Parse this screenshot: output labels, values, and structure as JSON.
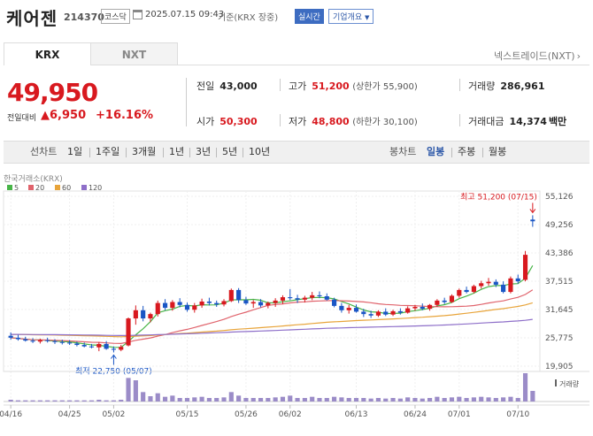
{
  "header": {
    "stock_name": "케어젠",
    "stock_code": "214370",
    "market_badge": "코스닥",
    "datetime": "2025.07.15 09:43",
    "basis": "기준(KRX 장중)",
    "realtime_badge": "실시간",
    "company_info_button": "기업개요"
  },
  "tabs": [
    {
      "label": "KRX"
    },
    {
      "label": "NXT"
    }
  ],
  "nxt_link": "넥스트레이드(NXT)",
  "quote": {
    "price": "49,950",
    "change_label": "전일대비",
    "change_value": "6,950",
    "change_pct": "+16.16%",
    "prev_close_label": "전일",
    "prev_close": "43,000",
    "high_label": "고가",
    "high": "51,200",
    "upper_limit": "(상한가 55,900)",
    "volume_label": "거래량",
    "volume": "286,961",
    "open_label": "시가",
    "open": "50,300",
    "low_label": "저가",
    "low": "48,800",
    "lower_limit": "(하한가 30,100)",
    "trade_value_label": "거래대금",
    "trade_value": "14,374",
    "trade_value_unit": "백만"
  },
  "period_bar": {
    "line_chart_label": "선차트",
    "periods": [
      "1일",
      "1주일",
      "3개월",
      "1년",
      "3년",
      "5년",
      "10년"
    ],
    "candle_label": "봉차트",
    "candle_periods": [
      "일봉",
      "주봉",
      "월봉"
    ],
    "selected_candle": "일봉"
  },
  "colors": {
    "up": "#d8191f",
    "down": "#1a56c5",
    "accent": "#2d58a8"
  },
  "chart_data": {
    "type": "candlestick",
    "title": "한국거래소(KRX)",
    "legend": [
      {
        "name": "5",
        "color": "#48b548"
      },
      {
        "name": "20",
        "color": "#e0636c"
      },
      {
        "name": "60",
        "color": "#e8a43a"
      },
      {
        "name": "120",
        "color": "#8e6fc9"
      }
    ],
    "y_ticks": [
      "55,126",
      "49,256",
      "43,386",
      "37,515",
      "31,645",
      "25,775",
      "19,905"
    ],
    "ylim": [
      19905,
      55126
    ],
    "x_ticks": [
      "04/16",
      "04/25",
      "05/02",
      "05/15",
      "05/26",
      "06/02",
      "06/13",
      "06/24",
      "07/01",
      "07/10"
    ],
    "x_tick_index": [
      0,
      8,
      14,
      24,
      32,
      38,
      47,
      55,
      61,
      69
    ],
    "annotations": {
      "max_label": "최고 51,200 (07/15)",
      "min_label": "최저 22,750 (05/07)"
    },
    "volume_label": "거래량",
    "candles": [
      {
        "o": 26200,
        "h": 26900,
        "l": 25400,
        "c": 25800
      },
      {
        "o": 25800,
        "h": 26400,
        "l": 25200,
        "c": 25500
      },
      {
        "o": 25500,
        "h": 26000,
        "l": 25000,
        "c": 25200
      },
      {
        "o": 25200,
        "h": 25700,
        "l": 24700,
        "c": 25000
      },
      {
        "o": 25000,
        "h": 25600,
        "l": 24600,
        "c": 25300
      },
      {
        "o": 25300,
        "h": 25800,
        "l": 24800,
        "c": 25100
      },
      {
        "o": 25100,
        "h": 25500,
        "l": 24500,
        "c": 24900
      },
      {
        "o": 24900,
        "h": 25400,
        "l": 24400,
        "c": 24800
      },
      {
        "o": 24800,
        "h": 25300,
        "l": 24300,
        "c": 24600
      },
      {
        "o": 24600,
        "h": 25000,
        "l": 24000,
        "c": 24300
      },
      {
        "o": 24300,
        "h": 24800,
        "l": 23800,
        "c": 24000
      },
      {
        "o": 24000,
        "h": 24500,
        "l": 23600,
        "c": 23800
      },
      {
        "o": 23800,
        "h": 24900,
        "l": 23000,
        "c": 24500
      },
      {
        "o": 24500,
        "h": 25100,
        "l": 23300,
        "c": 23500
      },
      {
        "o": 23500,
        "h": 24000,
        "l": 22750,
        "c": 23300
      },
      {
        "o": 23300,
        "h": 24300,
        "l": 23000,
        "c": 23900
      },
      {
        "o": 24200,
        "h": 30000,
        "l": 24000,
        "c": 29800
      },
      {
        "o": 29800,
        "h": 32500,
        "l": 28500,
        "c": 31500
      },
      {
        "o": 31500,
        "h": 32400,
        "l": 29200,
        "c": 29800
      },
      {
        "o": 29800,
        "h": 31000,
        "l": 29000,
        "c": 30700
      },
      {
        "o": 30700,
        "h": 33500,
        "l": 30200,
        "c": 33000
      },
      {
        "o": 33000,
        "h": 33800,
        "l": 31500,
        "c": 32000
      },
      {
        "o": 32000,
        "h": 33600,
        "l": 31400,
        "c": 33200
      },
      {
        "o": 33200,
        "h": 34000,
        "l": 32100,
        "c": 32600
      },
      {
        "o": 32600,
        "h": 33100,
        "l": 31200,
        "c": 31600
      },
      {
        "o": 31600,
        "h": 33000,
        "l": 31000,
        "c": 32500
      },
      {
        "o": 32500,
        "h": 33900,
        "l": 32000,
        "c": 33300
      },
      {
        "o": 33300,
        "h": 34100,
        "l": 32500,
        "c": 33000
      },
      {
        "o": 33000,
        "h": 33500,
        "l": 32200,
        "c": 32700
      },
      {
        "o": 32700,
        "h": 33800,
        "l": 32300,
        "c": 33400
      },
      {
        "o": 33400,
        "h": 36000,
        "l": 33200,
        "c": 35700
      },
      {
        "o": 35700,
        "h": 36100,
        "l": 33000,
        "c": 33600
      },
      {
        "o": 33600,
        "h": 34300,
        "l": 32600,
        "c": 32900
      },
      {
        "o": 32900,
        "h": 33600,
        "l": 32000,
        "c": 33200
      },
      {
        "o": 33200,
        "h": 33800,
        "l": 32100,
        "c": 32500
      },
      {
        "o": 32500,
        "h": 33300,
        "l": 31900,
        "c": 33000
      },
      {
        "o": 33000,
        "h": 34000,
        "l": 32200,
        "c": 33500
      },
      {
        "o": 33500,
        "h": 34600,
        "l": 32800,
        "c": 34200
      },
      {
        "o": 34200,
        "h": 35900,
        "l": 33600,
        "c": 34000
      },
      {
        "o": 34000,
        "h": 34700,
        "l": 33000,
        "c": 33700
      },
      {
        "o": 33700,
        "h": 34500,
        "l": 33100,
        "c": 34100
      },
      {
        "o": 34100,
        "h": 35300,
        "l": 33600,
        "c": 34600
      },
      {
        "o": 34600,
        "h": 35400,
        "l": 34000,
        "c": 34400
      },
      {
        "o": 34400,
        "h": 35000,
        "l": 33500,
        "c": 33700
      },
      {
        "o": 33700,
        "h": 34100,
        "l": 32100,
        "c": 32400
      },
      {
        "o": 32400,
        "h": 33000,
        "l": 31000,
        "c": 31500
      },
      {
        "o": 31500,
        "h": 32600,
        "l": 30800,
        "c": 32000
      },
      {
        "o": 32000,
        "h": 32700,
        "l": 31000,
        "c": 31200
      },
      {
        "o": 31200,
        "h": 31800,
        "l": 30100,
        "c": 30700
      },
      {
        "o": 30700,
        "h": 31400,
        "l": 29900,
        "c": 30400
      },
      {
        "o": 30400,
        "h": 31500,
        "l": 30100,
        "c": 31200
      },
      {
        "o": 31200,
        "h": 31900,
        "l": 30300,
        "c": 30600
      },
      {
        "o": 30600,
        "h": 31600,
        "l": 30300,
        "c": 31300
      },
      {
        "o": 31300,
        "h": 31900,
        "l": 30600,
        "c": 31000
      },
      {
        "o": 31000,
        "h": 32300,
        "l": 30800,
        "c": 31900
      },
      {
        "o": 31900,
        "h": 32600,
        "l": 31400,
        "c": 32200
      },
      {
        "o": 32200,
        "h": 32900,
        "l": 31500,
        "c": 31800
      },
      {
        "o": 31800,
        "h": 32800,
        "l": 31400,
        "c": 32600
      },
      {
        "o": 32600,
        "h": 33800,
        "l": 32200,
        "c": 33500
      },
      {
        "o": 33500,
        "h": 34100,
        "l": 32800,
        "c": 33200
      },
      {
        "o": 33200,
        "h": 34800,
        "l": 33000,
        "c": 34500
      },
      {
        "o": 34500,
        "h": 36000,
        "l": 34100,
        "c": 35700
      },
      {
        "o": 35700,
        "h": 36400,
        "l": 35000,
        "c": 35300
      },
      {
        "o": 35300,
        "h": 36800,
        "l": 35000,
        "c": 36500
      },
      {
        "o": 36500,
        "h": 37600,
        "l": 36000,
        "c": 37100
      },
      {
        "o": 37100,
        "h": 38200,
        "l": 36600,
        "c": 37400
      },
      {
        "o": 37400,
        "h": 37900,
        "l": 36300,
        "c": 36800
      },
      {
        "o": 36800,
        "h": 37500,
        "l": 35000,
        "c": 35300
      },
      {
        "o": 35300,
        "h": 38500,
        "l": 35000,
        "c": 38100
      },
      {
        "o": 38100,
        "h": 38900,
        "l": 37000,
        "c": 37500
      },
      {
        "o": 37800,
        "h": 43800,
        "l": 37500,
        "c": 43000
      },
      {
        "o": 50300,
        "h": 51200,
        "l": 48800,
        "c": 49950
      }
    ],
    "volumes": [
      3,
      2,
      2,
      2,
      2,
      2,
      2,
      2,
      2,
      2,
      2,
      2,
      3,
      2,
      2,
      3,
      40,
      36,
      16,
      9,
      14,
      8,
      10,
      6,
      6,
      7,
      8,
      6,
      6,
      7,
      16,
      10,
      6,
      6,
      6,
      6,
      7,
      8,
      10,
      6,
      6,
      8,
      6,
      6,
      8,
      7,
      6,
      6,
      6,
      5,
      6,
      5,
      6,
      5,
      7,
      6,
      5,
      6,
      8,
      6,
      7,
      8,
      6,
      7,
      8,
      7,
      6,
      7,
      8,
      6,
      48,
      18
    ]
  }
}
